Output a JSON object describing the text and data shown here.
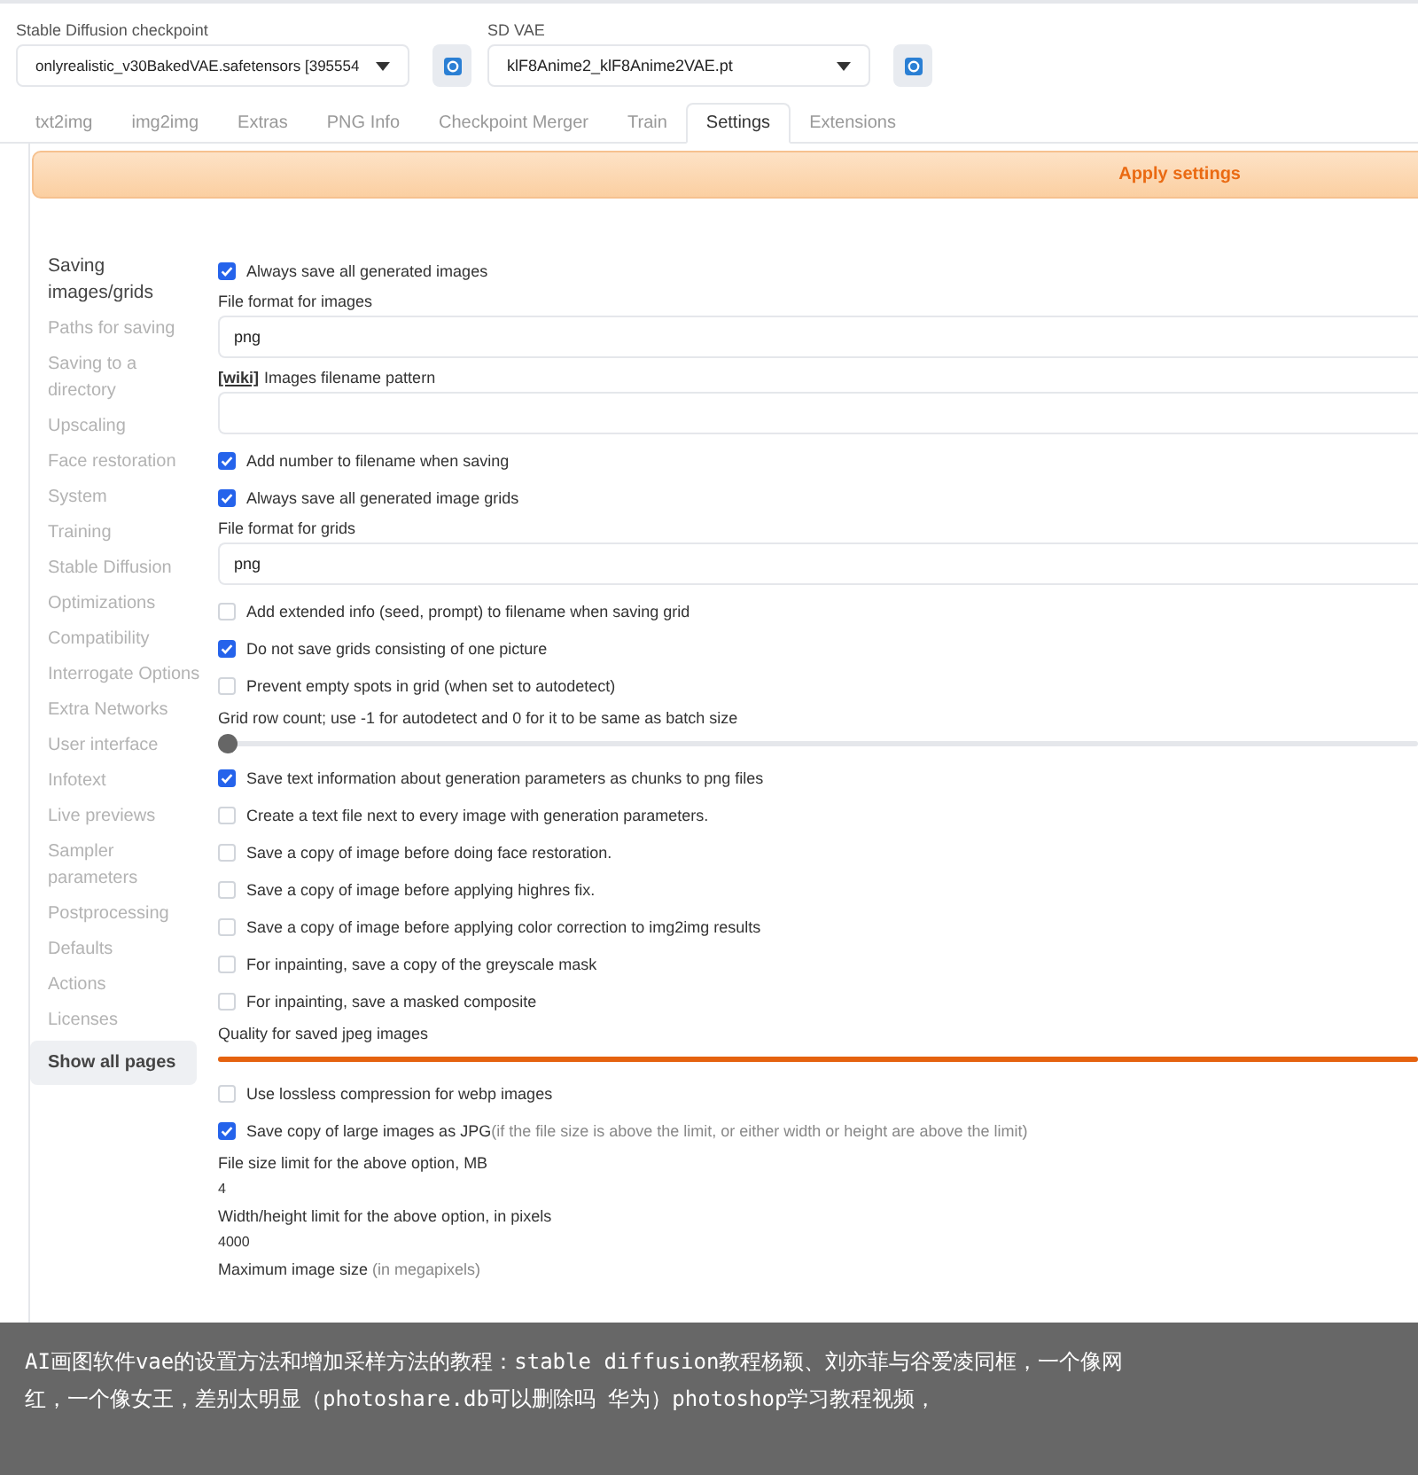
{
  "checkpoint": {
    "label": "Stable Diffusion checkpoint",
    "value": "onlyrealistic_v30BakedVAE.safetensors [395554"
  },
  "vae": {
    "label": "SD VAE",
    "value": "klF8Anime2_klF8Anime2VAE.pt"
  },
  "tabs": [
    {
      "label": "txt2img",
      "selected": false
    },
    {
      "label": "img2img",
      "selected": false
    },
    {
      "label": "Extras",
      "selected": false
    },
    {
      "label": "PNG Info",
      "selected": false
    },
    {
      "label": "Checkpoint Merger",
      "selected": false
    },
    {
      "label": "Train",
      "selected": false
    },
    {
      "label": "Settings",
      "selected": true
    },
    {
      "label": "Extensions",
      "selected": false
    }
  ],
  "apply_button": "Apply settings",
  "sidebar": {
    "items": [
      {
        "label": "Saving images/grids",
        "selected": true
      },
      {
        "label": "Paths for saving",
        "selected": false
      },
      {
        "label": "Saving to a directory",
        "selected": false
      },
      {
        "label": "Upscaling",
        "selected": false
      },
      {
        "label": "Face restoration",
        "selected": false
      },
      {
        "label": "System",
        "selected": false
      },
      {
        "label": "Training",
        "selected": false
      },
      {
        "label": "Stable Diffusion",
        "selected": false
      },
      {
        "label": "Optimizations",
        "selected": false
      },
      {
        "label": "Compatibility",
        "selected": false
      },
      {
        "label": "Interrogate Options",
        "selected": false
      },
      {
        "label": "Extra Networks",
        "selected": false
      },
      {
        "label": "User interface",
        "selected": false
      },
      {
        "label": "Infotext",
        "selected": false
      },
      {
        "label": "Live previews",
        "selected": false
      },
      {
        "label": "Sampler parameters",
        "selected": false
      },
      {
        "label": "Postprocessing",
        "selected": false
      },
      {
        "label": "Defaults",
        "selected": false
      },
      {
        "label": "Actions",
        "selected": false
      },
      {
        "label": "Licenses",
        "selected": false
      }
    ],
    "show_all": "Show all pages"
  },
  "settings": [
    {
      "kind": "checkbox",
      "label": "Always save all generated images",
      "checked": true
    },
    {
      "kind": "field",
      "label": "File format for images",
      "value": "png"
    },
    {
      "kind": "field",
      "link": "[wiki]",
      "label": "Images filename pattern"
    },
    {
      "kind": "checkbox",
      "label": "Add number to filename when saving",
      "checked": true
    },
    {
      "kind": "checkbox",
      "label": "Always save all generated image grids",
      "checked": true
    },
    {
      "kind": "field",
      "label": "File format for grids",
      "value": "png"
    },
    {
      "kind": "checkbox",
      "label": "Add extended info (seed, prompt) to filename when saving grid",
      "checked": false
    },
    {
      "kind": "checkbox",
      "label": "Do not save grids consisting of one picture",
      "checked": true
    },
    {
      "kind": "checkbox",
      "label": "Prevent empty spots in grid (when set to autodetect)",
      "checked": false
    },
    {
      "kind": "slider",
      "label": "Grid row count; use -1 for autodetect and 0 for it to be same as batch size",
      "level": 0
    },
    {
      "kind": "checkbox",
      "label": "Save text information about generation parameters as chunks to png files",
      "checked": true
    },
    {
      "kind": "checkbox",
      "label": "Create a text file next to every image with generation parameters.",
      "checked": false
    },
    {
      "kind": "checkbox",
      "label": "Save a copy of image before doing face restoration.",
      "checked": false
    },
    {
      "kind": "checkbox",
      "label": "Save a copy of image before applying highres fix.",
      "checked": false
    },
    {
      "kind": "checkbox",
      "label": "Save a copy of image before applying color correction to img2img results",
      "checked": false
    },
    {
      "kind": "checkbox",
      "label": "For inpainting, save a copy of the greyscale mask",
      "checked": false
    },
    {
      "kind": "checkbox",
      "label": "For inpainting, save a masked composite",
      "checked": false
    },
    {
      "kind": "slider",
      "label": "Quality for saved jpeg images",
      "level": 1
    },
    {
      "kind": "checkbox",
      "label": "Use lossless compression for webp images",
      "checked": false
    },
    {
      "kind": "checkbox",
      "label": "Save copy of large images as JPG",
      "hint": "(if the file size is above the limit, or either width or height are above the limit)",
      "checked": true
    },
    {
      "kind": "number",
      "label": "File size limit for the above option, MB",
      "value": "4"
    },
    {
      "kind": "number",
      "label": "Width/height limit for the above option, in pixels",
      "value": "4000"
    },
    {
      "kind": "heading",
      "label": "Maximum image size",
      "hint": "(in megapixels)"
    }
  ],
  "caption": "AI画图软件vae的设置方法和增加采样方法的教程：stable diffusion教程杨颖、刘亦菲与谷爱凌同框，一个像网红，一个像女王，差别太明显（photoshare.db可以删除吗 华为）photoshop学习教程视频，"
}
